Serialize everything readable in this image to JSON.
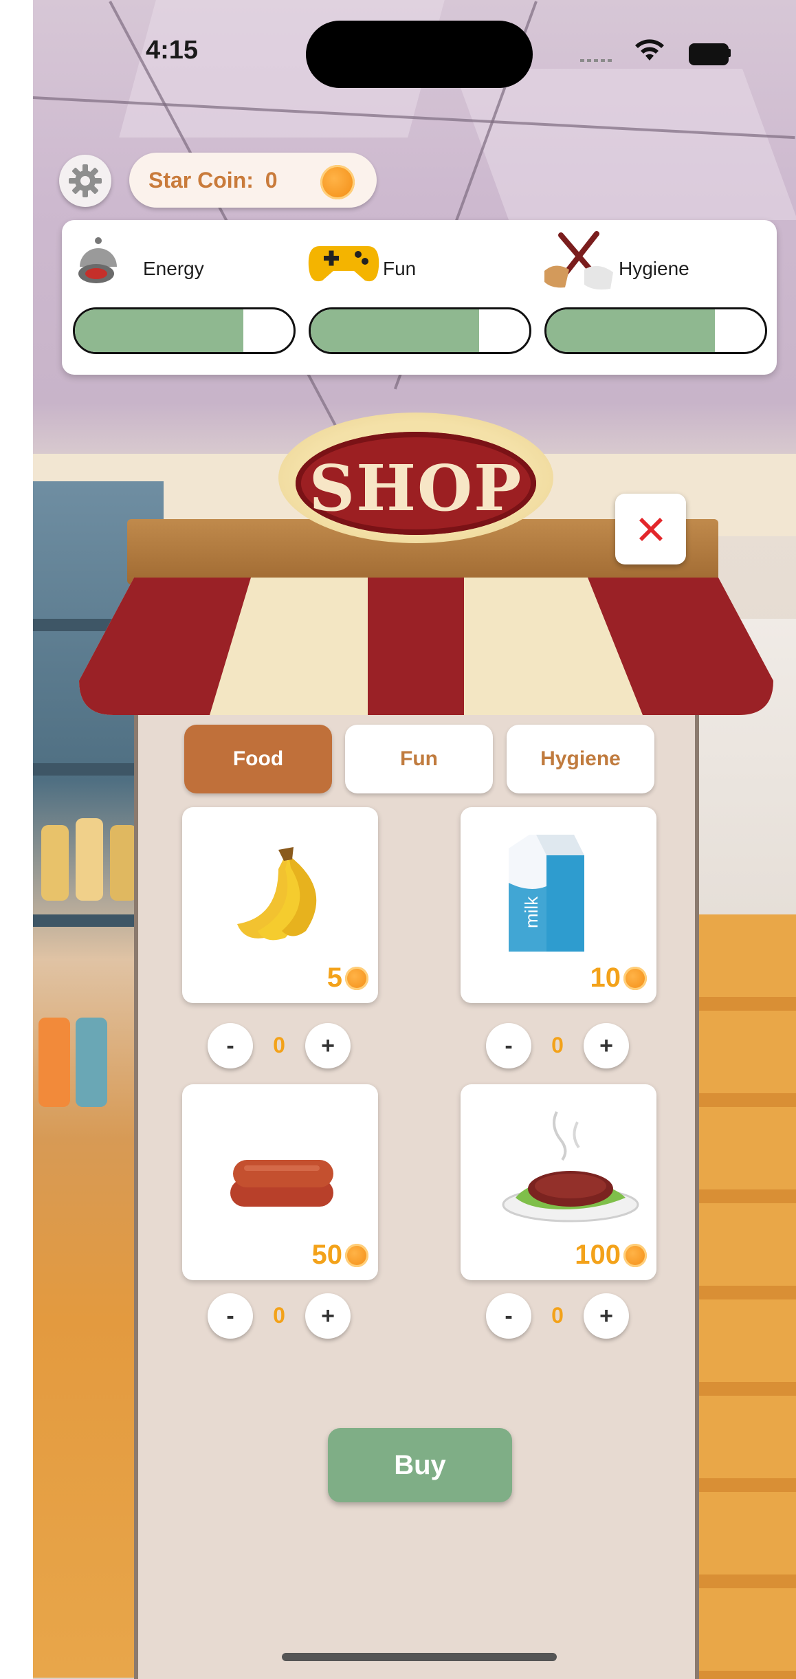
{
  "status_bar": {
    "time": "4:15"
  },
  "hud": {
    "coin_label": "Star Coin:",
    "coin_value": "0",
    "stats": [
      {
        "label": "Energy",
        "icon": "food-cloche-icon",
        "level": 0.77
      },
      {
        "label": "Fun",
        "icon": "gamepad-icon",
        "level": 0.77
      },
      {
        "label": "Hygiene",
        "icon": "broom-icon",
        "level": 0.77
      }
    ]
  },
  "shop": {
    "sign": "SHOP",
    "tabs": [
      {
        "label": "Food",
        "active": true
      },
      {
        "label": "Fun",
        "active": false
      },
      {
        "label": "Hygiene",
        "active": false
      }
    ],
    "items": [
      {
        "name": "banana",
        "price": "5",
        "quantity": "0"
      },
      {
        "name": "milk",
        "price": "10",
        "quantity": "0"
      },
      {
        "name": "sausage",
        "price": "50",
        "quantity": "0"
      },
      {
        "name": "steak",
        "price": "100",
        "quantity": "0"
      }
    ],
    "buy_label": "Buy",
    "minus_label": "-",
    "plus_label": "+"
  },
  "colors": {
    "accent": "#c0703a",
    "bar_fill": "#8fb890",
    "price": "#f3a21a",
    "buy": "#7fae86",
    "sign": "#9c1f22"
  }
}
